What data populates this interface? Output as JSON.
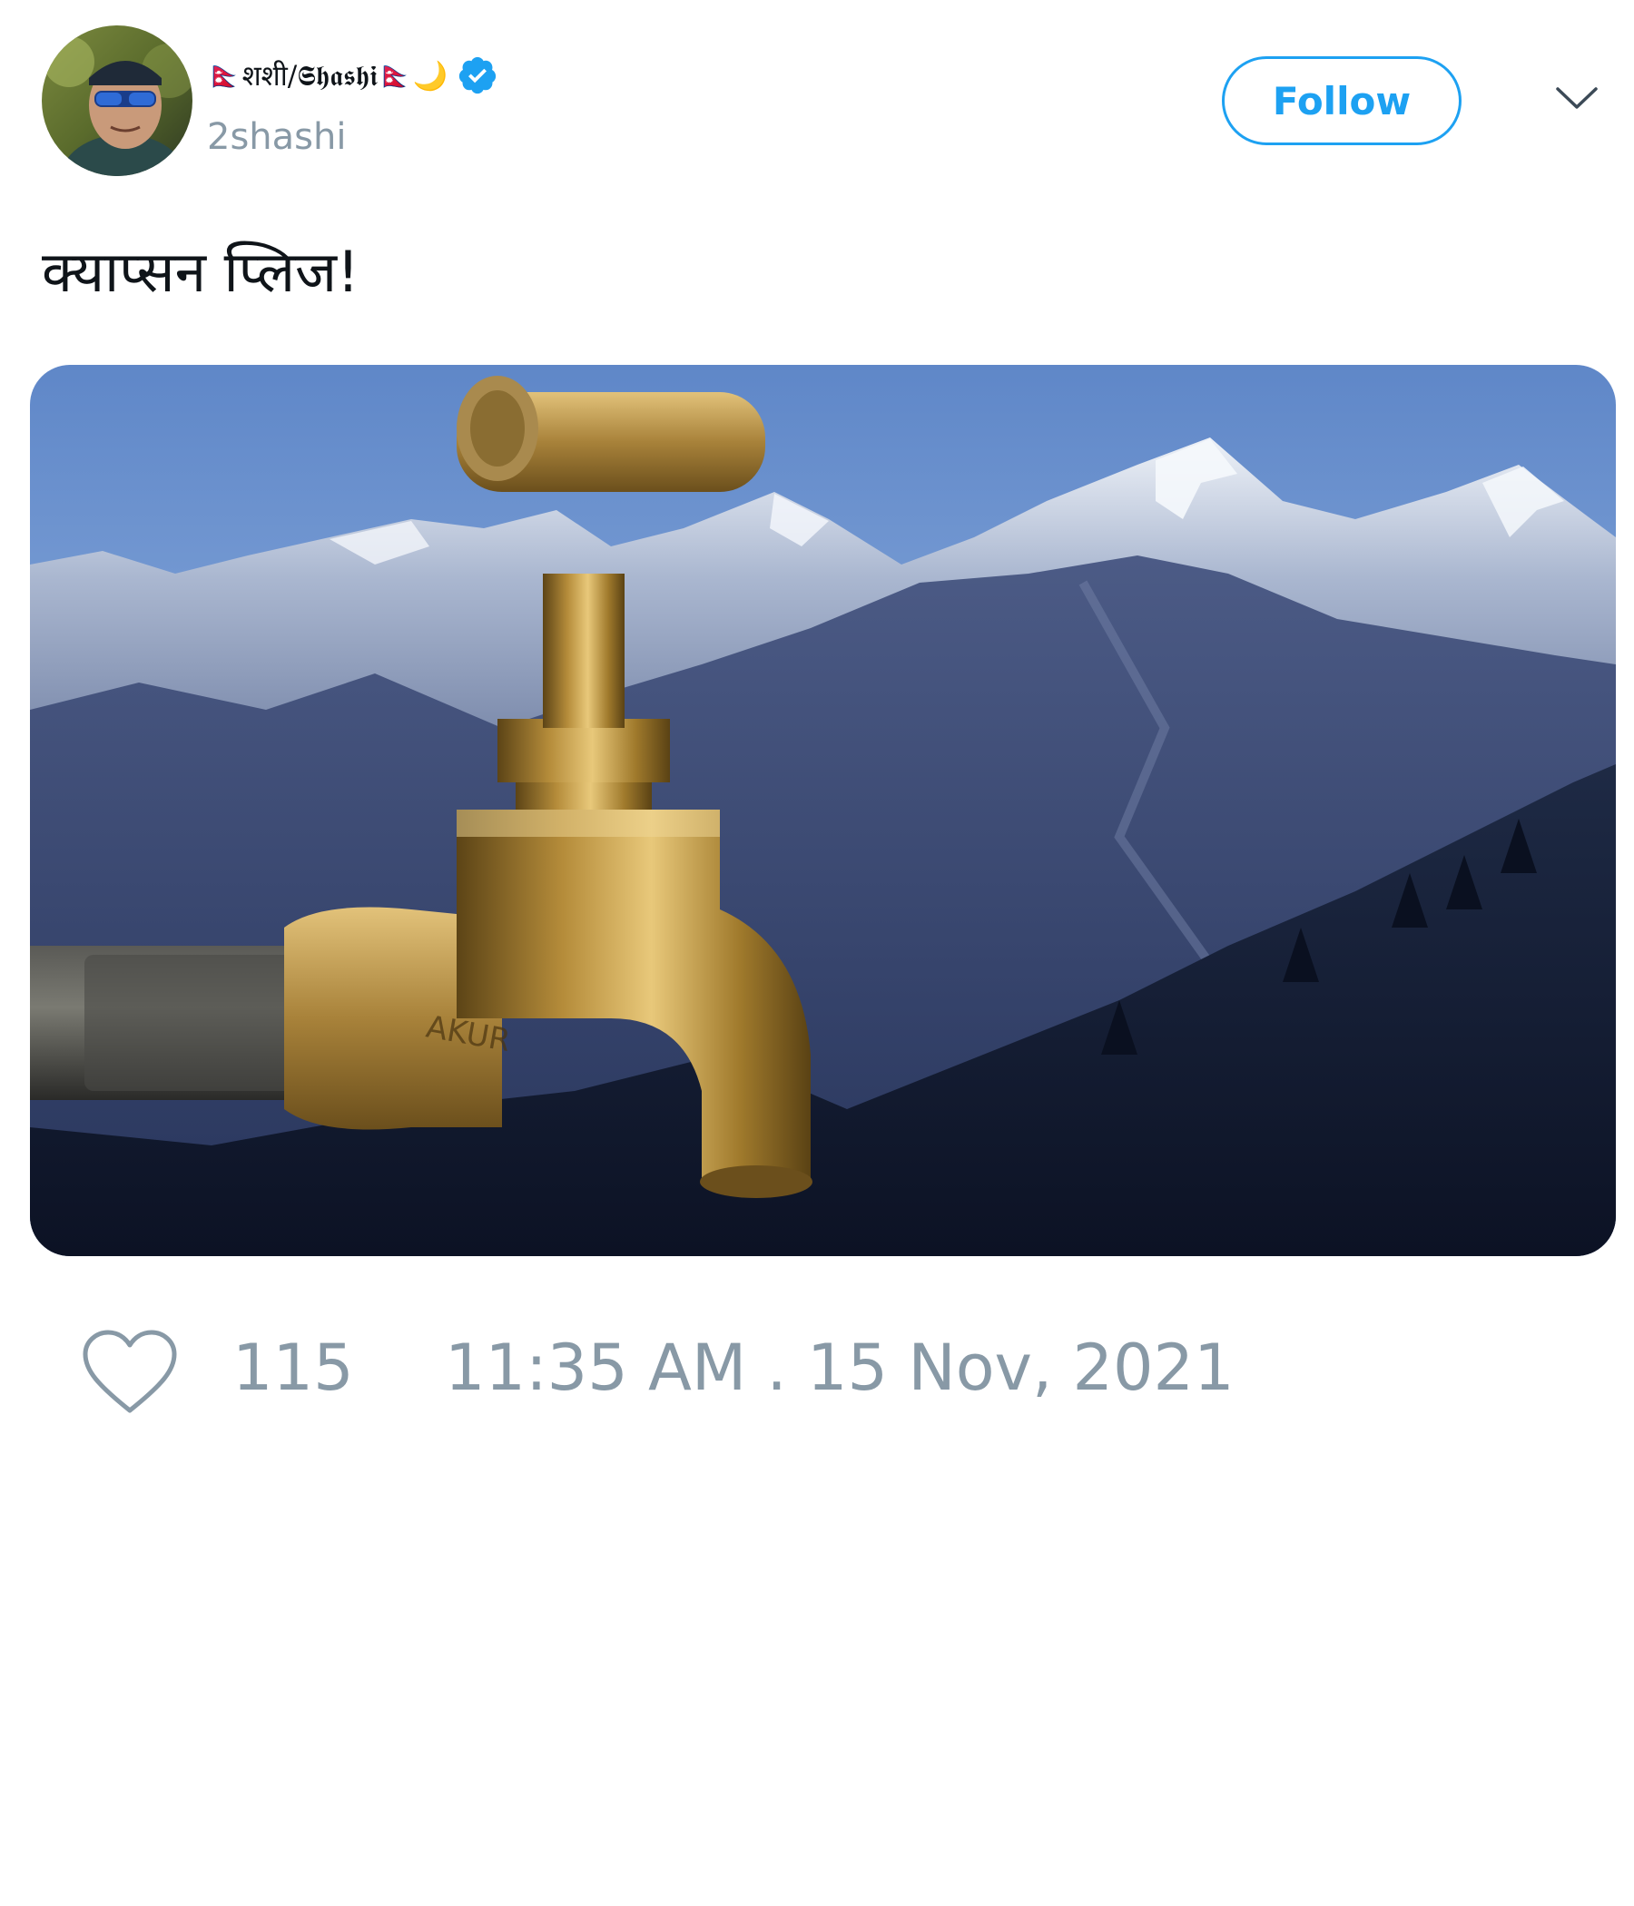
{
  "author": {
    "display_name": "🇳🇵शशी/𝕾𝖍𝖆𝖘𝖍𝖎🇳🇵🌙",
    "handle": "2shashi",
    "verified": true
  },
  "follow_button": {
    "label": "Follow"
  },
  "tweet": {
    "text": "क्याप्सन प्लिज!",
    "image_alt": "Brass water tap in front of snow-capped mountains"
  },
  "footer": {
    "likes": "115",
    "timestamp": "11:35 AM . 15 Nov, 2021"
  },
  "colors": {
    "accent": "#1da1f2",
    "muted": "#8899a6",
    "text": "#0f1419"
  },
  "icons": {
    "verified": "verified-badge-icon",
    "caret": "chevron-down-icon",
    "like": "heart-icon"
  }
}
